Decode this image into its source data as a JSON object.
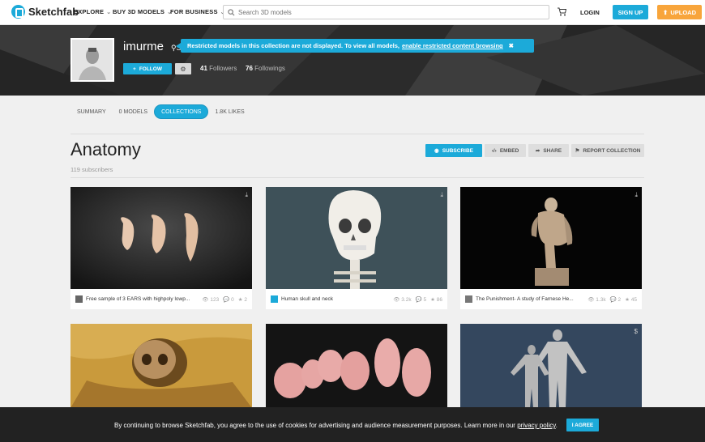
{
  "header": {
    "brand": "Sketchfab",
    "nav": [
      "EXPLORE",
      "BUY 3D MODELS",
      "FOR BUSINESS"
    ],
    "search_placeholder": "Search 3D models",
    "login": "LOGIN",
    "signup": "SIGN UP",
    "upload": "UPLOAD"
  },
  "profile": {
    "username": "imurme",
    "location_short": "S",
    "follow": "FOLLOW",
    "followers_count": "41",
    "followers_label": "Followers",
    "following_count": "76",
    "following_label": "Followings"
  },
  "alert": {
    "text": "Restricted models in this collection are not displayed. To view all models,",
    "link": "enable restricted content browsing"
  },
  "tabs": [
    {
      "label": "SUMMARY"
    },
    {
      "label": "0 MODELS"
    },
    {
      "label": "COLLECTIONS"
    },
    {
      "label": "1.8K LIKES"
    }
  ],
  "collection": {
    "title": "Anatomy",
    "subscribers": "119 subscribers",
    "subscribe": "SUBSCRIBE",
    "embed": "EMBED",
    "share": "SHARE",
    "report": "REPORT COLLECTION"
  },
  "models": [
    {
      "name": "Free sample of 3 EARS with highpoly lowp...",
      "views": "123",
      "comments": "0",
      "likes": "2",
      "thumb_icon": "download-icon"
    },
    {
      "name": "Human skull and neck",
      "views": "3.2k",
      "comments": "5",
      "likes": "86",
      "thumb_icon": "download-icon"
    },
    {
      "name": "The Punishment- A study of Farnese He...",
      "views": "1.3k",
      "comments": "2",
      "likes": "45",
      "thumb_icon": "download-icon"
    },
    {
      "name": "",
      "views": "",
      "comments": "",
      "likes": "",
      "thumb_icon": ""
    },
    {
      "name": "",
      "views": "",
      "comments": "",
      "likes": "",
      "thumb_icon": ""
    },
    {
      "name": "",
      "views": "",
      "comments": "",
      "likes": "",
      "thumb_icon": "$"
    }
  ],
  "cookie": {
    "text": "By continuing to browse Sketchfab, you agree to the use of cookies for advertising and audience measurement purposes. Learn more in our",
    "policy": "privacy policy",
    "period": ".",
    "agree": "I AGREE"
  },
  "colors": {
    "accent": "#1caad9",
    "upload": "#f8a53b",
    "hero": "#2e2e2e",
    "cookie_bar": "#222222"
  }
}
